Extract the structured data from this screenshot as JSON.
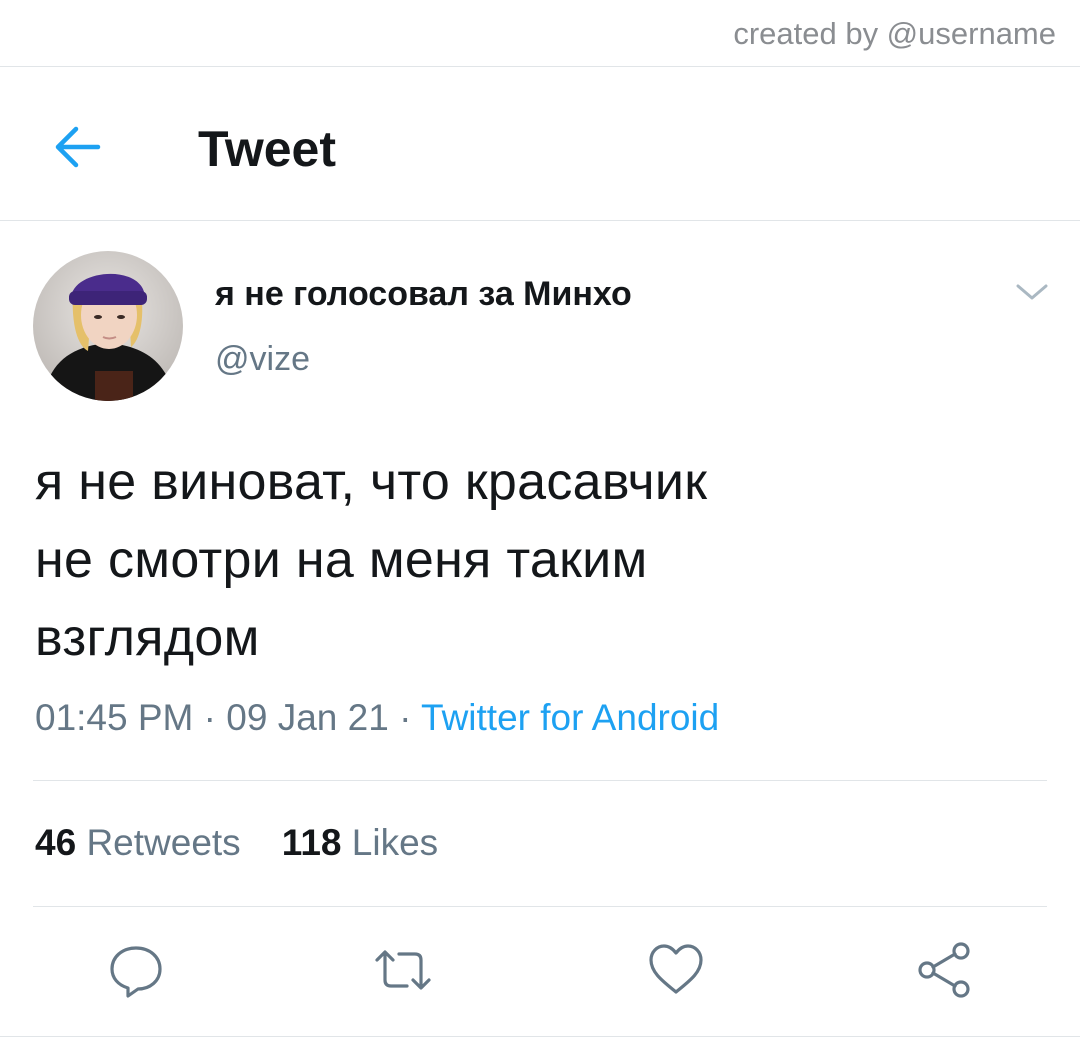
{
  "watermark": "created by @username",
  "header": {
    "title": "Tweet",
    "back_icon": "arrow-left-icon"
  },
  "author": {
    "display_name": "я не голосовал за Минхо",
    "handle": "@vize",
    "avatar": "avatar-photo"
  },
  "tweet": {
    "lines": [
      "я не виноват, что красавчик",
      "не смотри на меня таким",
      "взглядом"
    ]
  },
  "meta": {
    "time": "01:45 PM",
    "separator": "·",
    "date": "09 Jan 21",
    "source": "Twitter for Android"
  },
  "stats": {
    "retweets_count": "46",
    "retweets_label": "Retweets",
    "likes_count": "118",
    "likes_label": "Likes"
  },
  "actions": [
    "reply-icon",
    "retweet-icon",
    "like-icon",
    "share-icon"
  ],
  "colors": {
    "accent": "#1da1f2",
    "secondary_text": "#657786",
    "divider": "#e1e5e8"
  }
}
